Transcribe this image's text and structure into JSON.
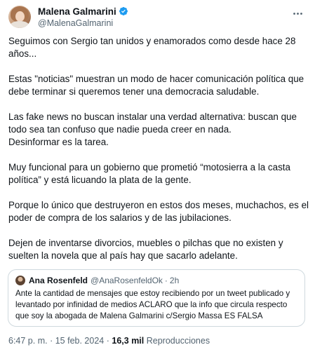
{
  "author": {
    "name": "Malena Galmarini",
    "handle": "@MalenaGalmarini",
    "verified": true,
    "avatar_icon": "profile-photo"
  },
  "more_icon": "ellipsis-icon",
  "accent_color": "#1d9bf0",
  "paragraphs": [
    "Seguimos con Sergio tan unidos y enamorados como desde hace 28\naños...",
    "Estas \"noticias\" muestran un modo de hacer comunicación política que\ndebe terminar si queremos tener una democracia saludable.",
    "Las fake news no buscan instalar una verdad alternativa: buscan que\ntodo sea tan confuso que nadie pueda creer en nada.\nDesinformar es la tarea.",
    "Muy funcional para un gobierno que prometió “motosierra a la casta\npolítica” y está licuando la plata de la gente.",
    "Porque lo único que destruyeron en estos dos meses, muchachos, es el\npoder de compra de los salarios y de las jubilaciones.",
    "Dejen de inventarse divorcios, muebles o pilchas que no existen y\nsuelten la novela que al país hay que sacarlo adelante."
  ],
  "quote": {
    "name": "Ana Rosenfeld",
    "handle": "@AnaRosenfeldOk",
    "separator": "·",
    "time": "2h",
    "text_lines": [
      "Ante la cantidad de mensajes que estoy recibiendo por un tweet publicado y",
      "levantado por infinidad de medios ACLARO que la info que circula  respecto",
      "que soy la abogada de Malena Galmarini c/Sergio Massa  ES FALSA"
    ]
  },
  "meta": {
    "time": "6:47 p. m.",
    "separator": "·",
    "date": "15 feb. 2024",
    "views_count": "16,3 mil",
    "views_label": "Reproducciones"
  }
}
